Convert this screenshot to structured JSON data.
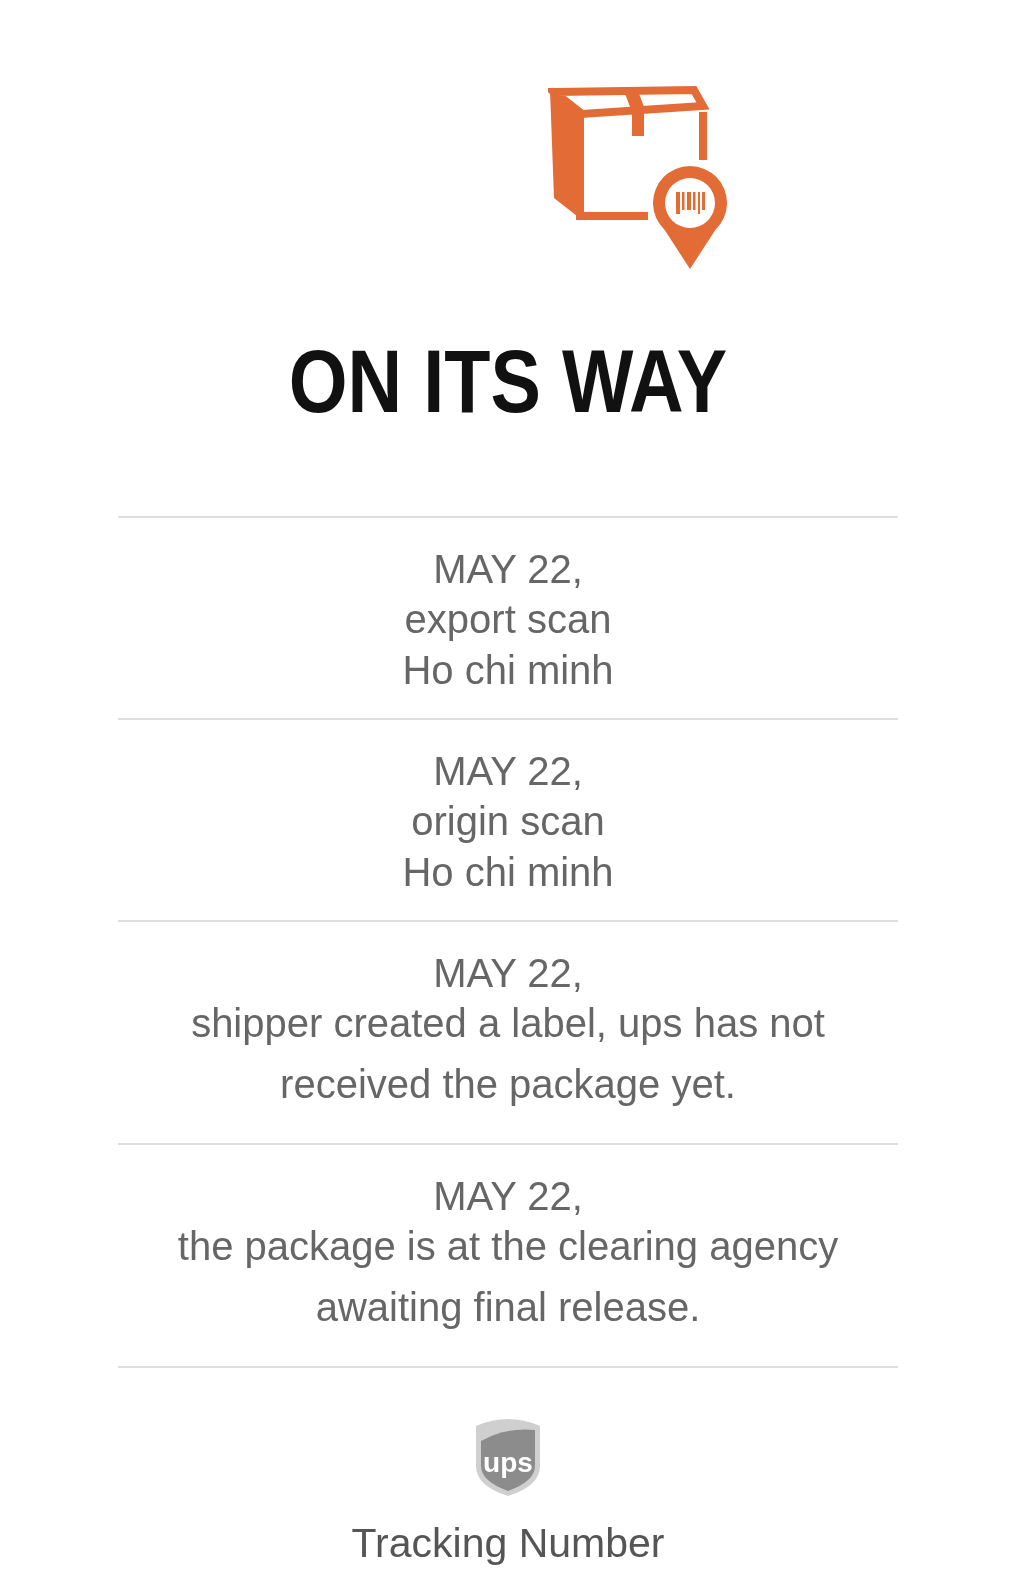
{
  "header": {
    "title": "ON ITS WAY"
  },
  "events": [
    {
      "date": "MAY 22,",
      "status": "export scan",
      "location": "Ho chi minh"
    },
    {
      "date": "MAY 22,",
      "status": "origin scan",
      "location": "Ho chi minh"
    },
    {
      "date": "MAY 22,",
      "status": "shipper created a label, ups has not received the package yet."
    },
    {
      "date": "MAY 22,",
      "status": "the package is at the clearing agency awaiting final release."
    }
  ],
  "footer": {
    "logo_text": "ups",
    "label": "Tracking Number"
  }
}
